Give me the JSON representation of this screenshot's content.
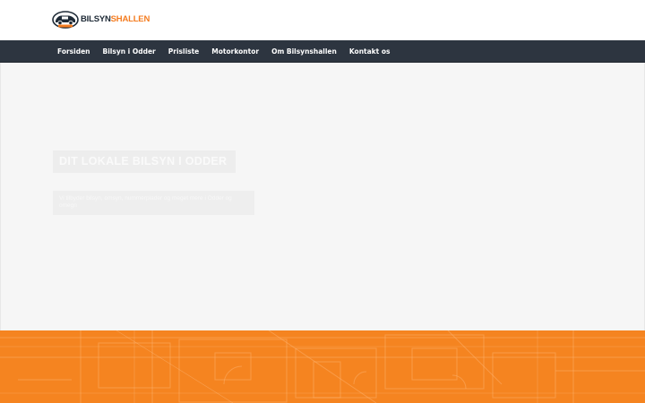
{
  "brand": {
    "name_part1": "BILSYN",
    "name_part2": "SHALLEN",
    "badge_text": "BILSYN",
    "primary_color": "#1e2a36",
    "accent_color": "#f47c20",
    "logo_icon": "car-icon"
  },
  "nav": {
    "items": [
      {
        "label": "Forsiden"
      },
      {
        "label": "Bilsyn i Odder"
      },
      {
        "label": "Prisliste"
      },
      {
        "label": "Motorkontor"
      },
      {
        "label": "Om Bilsynshallen"
      },
      {
        "label": "Kontakt os"
      }
    ],
    "background": "#2d3540"
  },
  "hero": {
    "title": "DIT LOKALE BILSYN I ODDER",
    "subtitle": "Vi tilbyder bilsyn, omsyn, nummerplader og meget mere i Odder og omegn"
  },
  "footer_band": {
    "color": "#f58420",
    "pattern": "blueprint-floorplan"
  }
}
